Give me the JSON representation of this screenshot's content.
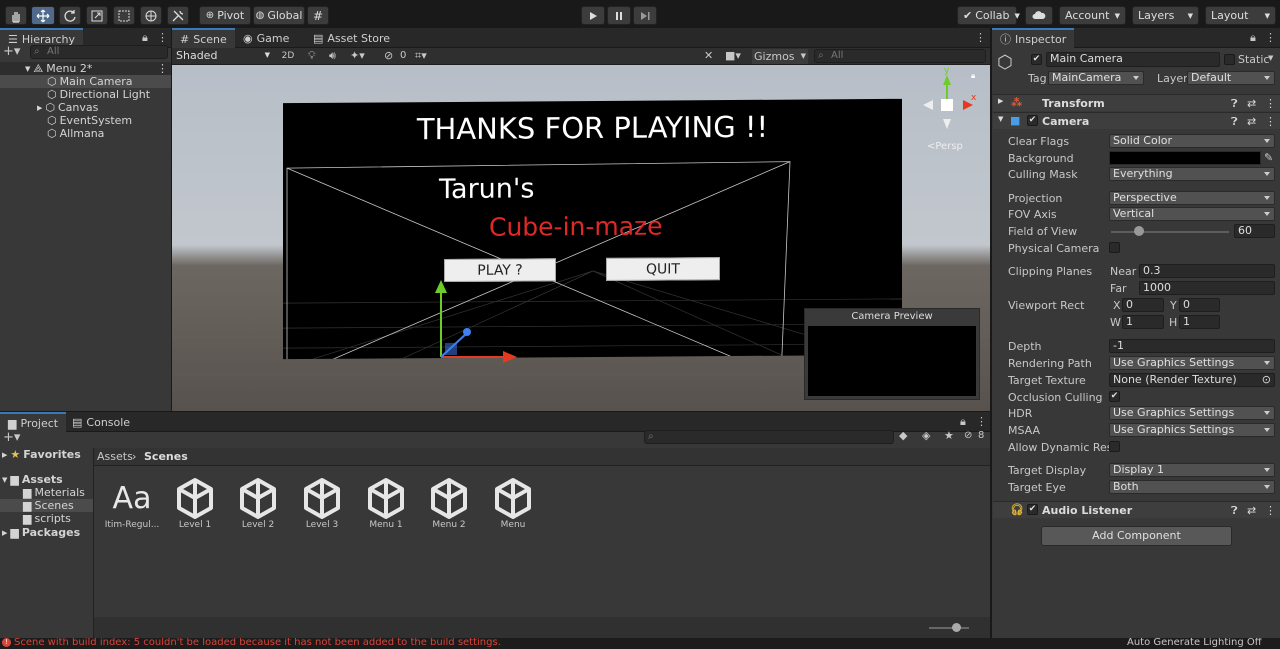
{
  "toolbar": {
    "pivot_label": "Pivot",
    "global_label": "Global",
    "collab_label": "Collab",
    "account_label": "Account",
    "layers_label": "Layers",
    "layout_label": "Layout"
  },
  "hierarchy": {
    "tab_label": "Hierarchy",
    "search_placeholder": "All",
    "scene_name": "Menu 2*",
    "items": [
      "Main Camera",
      "Directional Light",
      "Canvas",
      "EventSystem",
      "Allmana"
    ]
  },
  "scene_view": {
    "tabs": [
      "Scene",
      "Game",
      "Asset Store"
    ],
    "shading_mode": "Shaded",
    "mode_2d": "2D",
    "hidden_count": "0",
    "gizmos_label": "Gizmos",
    "search_placeholder": "All",
    "persp_label": "<Persp",
    "canvas": {
      "title": "THANKS FOR PLAYING !!",
      "author": "Tarun's",
      "game_name": "Cube-in-maze",
      "play_button": "PLAY ?",
      "quit_button": "QUIT"
    },
    "camera_preview_title": "Camera Preview",
    "gizmo_axes": {
      "y": "y",
      "x": "x"
    }
  },
  "project": {
    "tabs": [
      "Project",
      "Console"
    ],
    "breadcrumb": [
      "Assets",
      "Scenes"
    ],
    "hidden_count": "8",
    "tree": {
      "favorites": "Favorites",
      "assets": "Assets",
      "folders": [
        "Meterials",
        "Scenes",
        "scripts"
      ],
      "packages": "Packages"
    },
    "assets": [
      {
        "name": "Itim-Regul...",
        "type": "font",
        "glyph": "Aa"
      },
      {
        "name": "Level 1",
        "type": "scene"
      },
      {
        "name": "Level 2",
        "type": "scene"
      },
      {
        "name": "Level 3",
        "type": "scene"
      },
      {
        "name": "Menu 1",
        "type": "scene"
      },
      {
        "name": "Menu 2",
        "type": "scene"
      },
      {
        "name": "Menu",
        "type": "scene"
      }
    ]
  },
  "inspector": {
    "tab_label": "Inspector",
    "object_name": "Main Camera",
    "static_label": "Static",
    "tag_label": "Tag",
    "tag_value": "MainCamera",
    "layer_label": "Layer",
    "layer_value": "Default",
    "transform_label": "Transform",
    "camera_label": "Camera",
    "clear_flags": {
      "label": "Clear Flags",
      "value": "Solid Color"
    },
    "background": {
      "label": "Background",
      "color": "#000000"
    },
    "culling_mask": {
      "label": "Culling Mask",
      "value": "Everything"
    },
    "projection": {
      "label": "Projection",
      "value": "Perspective"
    },
    "fov_axis": {
      "label": "FOV Axis",
      "value": "Vertical"
    },
    "field_of_view": {
      "label": "Field of View",
      "value": "60",
      "slider_fraction": 0.24
    },
    "physical_camera": {
      "label": "Physical Camera"
    },
    "clipping_planes": {
      "label": "Clipping Planes",
      "near_label": "Near",
      "near": "0.3",
      "far_label": "Far",
      "far": "1000"
    },
    "viewport_rect": {
      "label": "Viewport Rect",
      "x_label": "X",
      "x": "0",
      "y_label": "Y",
      "y": "0",
      "w_label": "W",
      "w": "1",
      "h_label": "H",
      "h": "1"
    },
    "depth": {
      "label": "Depth",
      "value": "-1"
    },
    "rendering_path": {
      "label": "Rendering Path",
      "value": "Use Graphics Settings"
    },
    "target_texture": {
      "label": "Target Texture",
      "value": "None (Render Texture)"
    },
    "occlusion_culling": {
      "label": "Occlusion Culling"
    },
    "hdr": {
      "label": "HDR",
      "value": "Use Graphics Settings"
    },
    "msaa": {
      "label": "MSAA",
      "value": "Use Graphics Settings"
    },
    "allow_dynamic": {
      "label": "Allow Dynamic Reso"
    },
    "target_display": {
      "label": "Target Display",
      "value": "Display 1"
    },
    "target_eye": {
      "label": "Target Eye",
      "value": "Both"
    },
    "audio_listener_label": "Audio Listener",
    "add_component_label": "Add Component"
  },
  "status": {
    "error_message": "Scene with build index: 5 couldn't be loaded because it has not been added to the build settings.",
    "right_text": "Auto Generate Lighting Off"
  },
  "colors": {
    "accent": "#3a79bb",
    "error": "#d9453b",
    "canvas_red": "#e02828"
  }
}
